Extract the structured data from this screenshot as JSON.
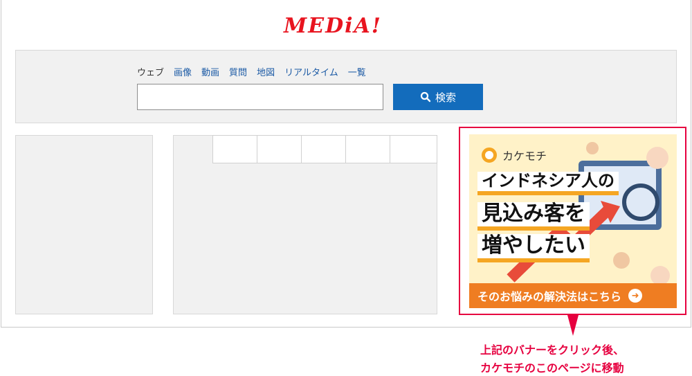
{
  "logo": {
    "text": "MEDiA!"
  },
  "search": {
    "tabs": [
      "ウェブ",
      "画像",
      "動画",
      "質問",
      "地図",
      "リアルタイム",
      "一覧"
    ],
    "active_tab": "ウェブ",
    "input_value": "",
    "button_label": "検索",
    "button_icon": "search-icon",
    "accent_color": "#136cbc"
  },
  "ad": {
    "brand": "カケモチ",
    "headline_lines": [
      "インドネシア人の",
      "見込み客を",
      "増やしたい"
    ],
    "cta": "そのお悩みの解決法はこちら",
    "outline_color": "#e6003f",
    "cta_color": "#ef7d22"
  },
  "annotation": {
    "lines": [
      "上記のバナーをクリック後、",
      "カケモチのこのページに移動"
    ],
    "color": "#e6003f"
  }
}
